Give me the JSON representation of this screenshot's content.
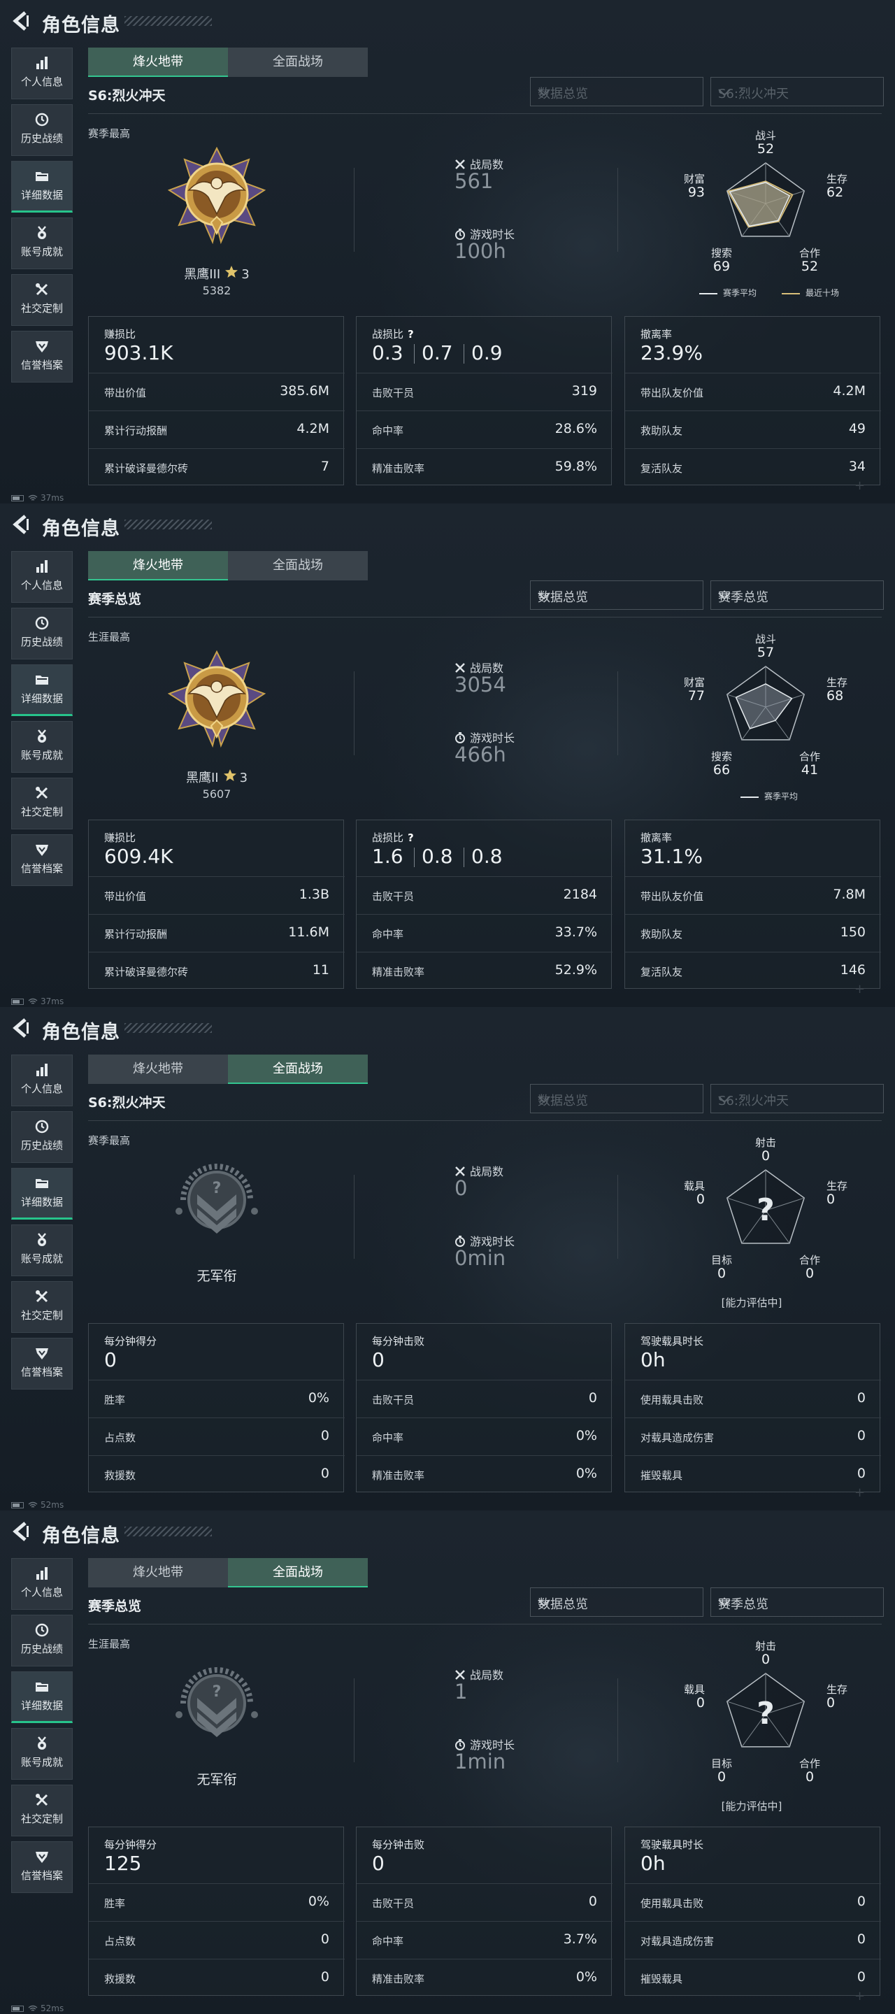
{
  "common": {
    "page_title": "角色信息",
    "sidebar": [
      {
        "label": "个人信息",
        "icon": "bar-chart-icon"
      },
      {
        "label": "历史战绩",
        "icon": "clock-icon"
      },
      {
        "label": "详细数据",
        "icon": "folder-icon"
      },
      {
        "label": "账号成就",
        "icon": "medal-icon"
      },
      {
        "label": "社交定制",
        "icon": "tools-icon"
      },
      {
        "label": "信誉档案",
        "icon": "shield-icon"
      }
    ],
    "tab1": "烽火地带",
    "tab2": "全面战场",
    "battles_label": "战局数",
    "playtime_label": "游戏时长",
    "accent_color": "#33c690"
  },
  "screens": [
    {
      "active_tab": 1,
      "season_title": "S6:烈火冲天",
      "dropdown1": "数据总览",
      "dropdown2": "S6:烈火冲天",
      "dropdowns_dim": true,
      "best_label": "赛季最高",
      "rank_name": "黑鹰III",
      "rank_stars": "3",
      "rank_score": "5382",
      "battles": "561",
      "playtime": "100h",
      "radar": {
        "labels": [
          "战斗",
          "生存",
          "合作",
          "搜索",
          "财富"
        ],
        "values": [
          "52",
          "62",
          "52",
          "69",
          "93"
        ],
        "unknown": false,
        "norm": [
          0.52,
          0.62,
          0.52,
          0.69,
          0.93
        ],
        "norm_recent": [
          0.55,
          0.7,
          0.55,
          0.72,
          0.98
        ],
        "legend_avg": "赛季平均",
        "legend_recent": "最近十场",
        "note": ""
      },
      "cards": [
        {
          "label": "赚损比",
          "big": "903.1K",
          "rows": [
            [
              "带出价值",
              "385.6M"
            ],
            [
              "累计行动报酬",
              "4.2M"
            ],
            [
              "累计破译曼德尔砖",
              "7"
            ]
          ]
        },
        {
          "label": "战损比",
          "kd": [
            "0.3",
            "0.7",
            "0.9"
          ],
          "rows": [
            [
              "击败干员",
              "319"
            ],
            [
              "命中率",
              "28.6%"
            ],
            [
              "精准击败率",
              "59.8%"
            ]
          ]
        },
        {
          "label": "撤离率",
          "big": "23.9%",
          "rows": [
            [
              "带出队友价值",
              "4.2M"
            ],
            [
              "救助队友",
              "49"
            ],
            [
              "复活队友",
              "34"
            ]
          ]
        }
      ],
      "status_ping": "37ms"
    },
    {
      "active_tab": 1,
      "season_title": "赛季总览",
      "dropdown1": "数据总览",
      "dropdown2": "赛季总览",
      "dropdowns_dim": false,
      "best_label": "生涯最高",
      "rank_name": "黑鹰II",
      "rank_stars": "3",
      "rank_score": "5607",
      "battles": "3054",
      "playtime": "466h",
      "radar": {
        "labels": [
          "战斗",
          "生存",
          "合作",
          "搜索",
          "财富"
        ],
        "values": [
          "57",
          "68",
          "41",
          "66",
          "77"
        ],
        "unknown": false,
        "norm": [
          0.57,
          0.68,
          0.41,
          0.66,
          0.77
        ],
        "legend_avg": "赛季平均",
        "note": ""
      },
      "cards": [
        {
          "label": "赚损比",
          "big": "609.4K",
          "rows": [
            [
              "带出价值",
              "1.3B"
            ],
            [
              "累计行动报酬",
              "11.6M"
            ],
            [
              "累计破译曼德尔砖",
              "11"
            ]
          ]
        },
        {
          "label": "战损比",
          "kd": [
            "1.6",
            "0.8",
            "0.8"
          ],
          "rows": [
            [
              "击败干员",
              "2184"
            ],
            [
              "命中率",
              "33.7%"
            ],
            [
              "精准击败率",
              "52.9%"
            ]
          ]
        },
        {
          "label": "撤离率",
          "big": "31.1%",
          "rows": [
            [
              "带出队友价值",
              "7.8M"
            ],
            [
              "救助队友",
              "150"
            ],
            [
              "复活队友",
              "146"
            ]
          ]
        }
      ],
      "status_ping": "37ms"
    },
    {
      "active_tab": 2,
      "season_title": "S6:烈火冲天",
      "dropdown1": "数据总览",
      "dropdown2": "S6:烈火冲天",
      "dropdowns_dim": true,
      "best_label": "赛季最高",
      "no_rank": "无军衔",
      "battles": "0",
      "playtime": "0min",
      "radar": {
        "labels": [
          "射击",
          "生存",
          "合作",
          "目标",
          "载具"
        ],
        "values": [
          "0",
          "0",
          "0",
          "0",
          "0"
        ],
        "unknown": true,
        "note": "[能力评估中]"
      },
      "cards": [
        {
          "label": "每分钟得分",
          "big": "0",
          "rows": [
            [
              "胜率",
              "0%"
            ],
            [
              "占点数",
              "0"
            ],
            [
              "救援数",
              "0"
            ]
          ]
        },
        {
          "label": "每分钟击败",
          "big": "0",
          "rows": [
            [
              "击败干员",
              "0"
            ],
            [
              "命中率",
              "0%"
            ],
            [
              "精准击败率",
              "0%"
            ]
          ]
        },
        {
          "label": "驾驶载具时长",
          "big": "0h",
          "rows": [
            [
              "使用载具击败",
              "0"
            ],
            [
              "对载具造成伤害",
              "0"
            ],
            [
              "摧毁载具",
              "0"
            ]
          ]
        }
      ],
      "status_ping": "52ms"
    },
    {
      "active_tab": 2,
      "season_title": "赛季总览",
      "dropdown1": "数据总览",
      "dropdown2": "赛季总览",
      "dropdowns_dim": false,
      "best_label": "生涯最高",
      "no_rank": "无军衔",
      "battles": "1",
      "playtime": "1min",
      "radar": {
        "labels": [
          "射击",
          "生存",
          "合作",
          "目标",
          "载具"
        ],
        "values": [
          "0",
          "0",
          "0",
          "0",
          "0"
        ],
        "unknown": true,
        "note": "[能力评估中]"
      },
      "cards": [
        {
          "label": "每分钟得分",
          "big": "125",
          "rows": [
            [
              "胜率",
              "0%"
            ],
            [
              "占点数",
              "0"
            ],
            [
              "救援数",
              "0"
            ]
          ]
        },
        {
          "label": "每分钟击败",
          "big": "0",
          "rows": [
            [
              "击败干员",
              "0"
            ],
            [
              "命中率",
              "3.7%"
            ],
            [
              "精准击败率",
              "0%"
            ]
          ]
        },
        {
          "label": "驾驶载具时长",
          "big": "0h",
          "rows": [
            [
              "使用载具击败",
              "0"
            ],
            [
              "对载具造成伤害",
              "0"
            ],
            [
              "摧毁载具",
              "0"
            ]
          ]
        }
      ],
      "status_ping": "52ms"
    }
  ]
}
